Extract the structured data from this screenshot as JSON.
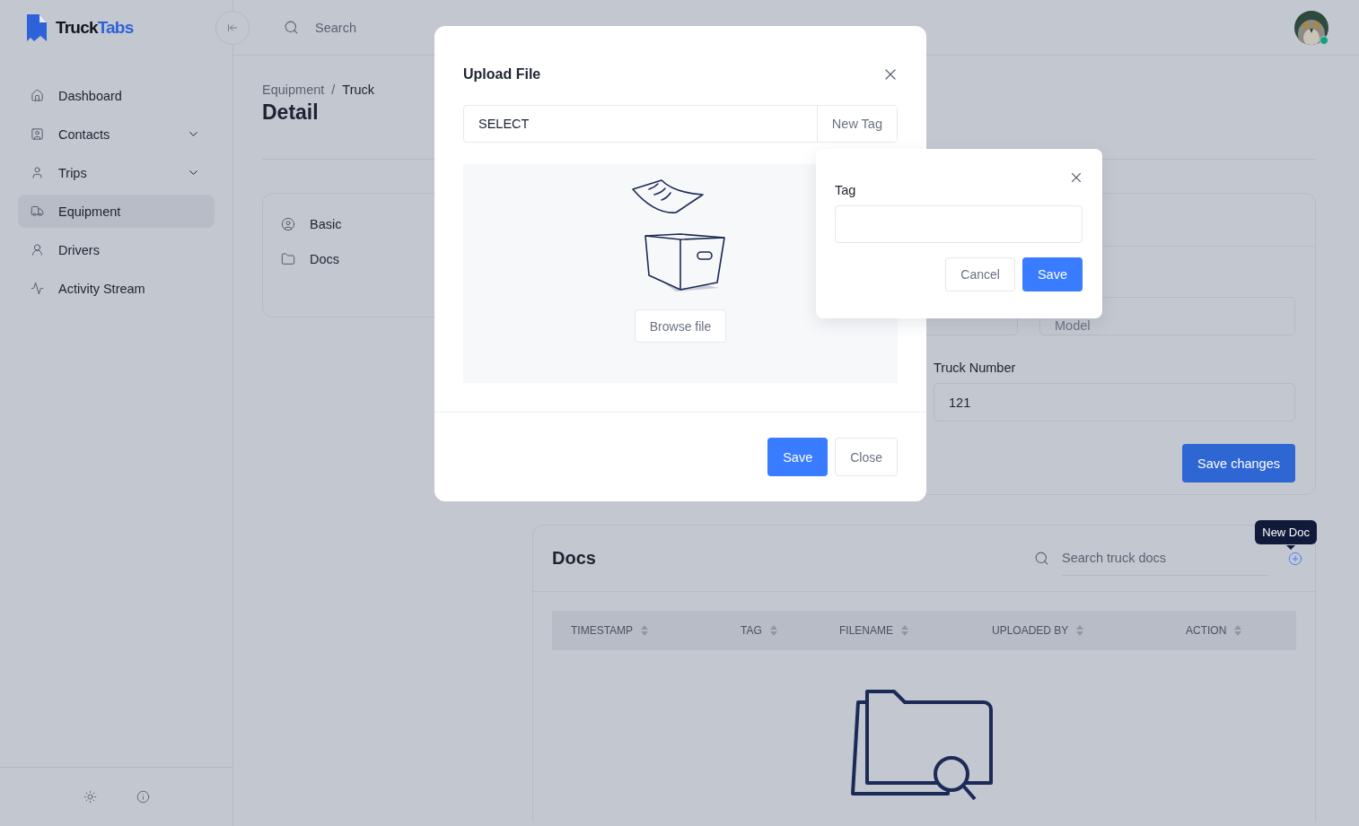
{
  "logo": {
    "words": [
      "Truck",
      "Tabs"
    ]
  },
  "sidebar": {
    "items": [
      {
        "label": "Dashboard",
        "expandable": false,
        "selected": false
      },
      {
        "label": "Contacts",
        "expandable": true,
        "selected": false
      },
      {
        "label": "Trips",
        "expandable": true,
        "selected": false
      },
      {
        "label": "Equipment",
        "expandable": false,
        "selected": true
      },
      {
        "label": "Drivers",
        "expandable": false,
        "selected": false
      },
      {
        "label": "Activity Stream",
        "expandable": false,
        "selected": false
      }
    ]
  },
  "header": {
    "search_placeholder": "Search",
    "user": {
      "online": true
    }
  },
  "breadcrumb": {
    "separator": "/",
    "items": [
      {
        "label": "Equipment",
        "current": false
      },
      {
        "label": "Truck",
        "current": true
      }
    ]
  },
  "page_title": "Detail",
  "section_menu": [
    {
      "label": "Basic"
    },
    {
      "label": "Docs"
    }
  ],
  "truck_form": {
    "model_placeholder": "Model",
    "truck_number_label": "Truck Number",
    "truck_number_value": "121",
    "save_button": "Save changes"
  },
  "docs": {
    "title": "Docs",
    "search_placeholder": "Search truck docs",
    "new_tooltip": "New Doc",
    "columns": [
      "TIMESTAMP",
      "TAG",
      "FILENAME",
      "UPLOADED BY",
      "ACTION"
    ]
  },
  "upload_modal": {
    "title": "Upload File",
    "tag_select": "SELECT",
    "new_tag_button": "New Tag",
    "browse_button": "Browse file",
    "buttons": [
      {
        "label": "Save",
        "kind": "primary"
      },
      {
        "label": "Close",
        "kind": "secondary"
      }
    ]
  },
  "tag_popover": {
    "label": "Tag",
    "buttons": [
      {
        "label": "Cancel",
        "kind": "secondary"
      },
      {
        "label": "Save",
        "kind": "primary"
      }
    ]
  }
}
